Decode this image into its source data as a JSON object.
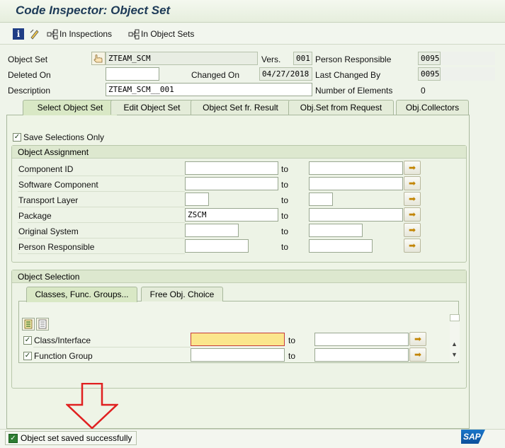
{
  "window": {
    "title": "Code Inspector: Object Set"
  },
  "toolbar": {
    "info_icon": "info-icon",
    "pencil_icon": "pencil-icon",
    "in_inspections_label": "In Inspections",
    "in_object_sets_label": "In Object Sets"
  },
  "header": {
    "object_set_label": "Object Set",
    "object_set_value": "ZTEAM_SCM",
    "vers_label": "Vers.",
    "vers_value": "001",
    "person_resp_label": "Person Responsible",
    "person_resp_value": "0095",
    "deleted_on_label": "Deleted On",
    "deleted_on_value": "",
    "changed_on_label": "Changed On",
    "changed_on_value": "04/27/2018",
    "last_changed_by_label": "Last Changed By",
    "last_changed_by_value": "0095",
    "description_label": "Description",
    "description_value": "ZTEAM_SCM__001",
    "num_elements_label": "Number of Elements",
    "num_elements_value": "0"
  },
  "tabs": [
    {
      "label": "Select Object Set",
      "active": true
    },
    {
      "label": "Edit Object Set",
      "active": false
    },
    {
      "label": "Object Set fr. Result",
      "active": false
    },
    {
      "label": "Obj.Set from Request",
      "active": false
    },
    {
      "label": "Obj.Collectors",
      "active": false
    }
  ],
  "save_selections_only": {
    "label": "Save Selections Only",
    "checked": true
  },
  "object_assignment": {
    "title": "Object Assignment",
    "to_label": "to",
    "rows": [
      {
        "label": "Component ID",
        "from": "",
        "to": ""
      },
      {
        "label": "Software Component",
        "from": "",
        "to": ""
      },
      {
        "label": "Transport Layer",
        "from": "",
        "to": ""
      },
      {
        "label": "Package",
        "from": "ZSCM",
        "to": ""
      },
      {
        "label": "Original System",
        "from": "",
        "to": ""
      },
      {
        "label": "Person Responsible",
        "from": "",
        "to": ""
      }
    ]
  },
  "object_selection": {
    "title": "Object Selection",
    "subtabs": [
      {
        "label": "Classes, Func. Groups...",
        "active": true
      },
      {
        "label": "Free Obj. Choice",
        "active": false
      }
    ],
    "to_label": "to",
    "rows": [
      {
        "label": "Class/Interface",
        "checked": true,
        "from": "",
        "to": ""
      },
      {
        "label": "Function Group",
        "checked": true,
        "from": "",
        "to": ""
      }
    ]
  },
  "status": {
    "message": "Object set saved successfully",
    "status_icon": "success-check-icon",
    "logo_text": "SAP"
  },
  "colors": {
    "title": "#1d3a57",
    "status_ok": "#2e7d32",
    "annotation_arrow": "#e02020",
    "sap_blue": "#0a4f9a"
  }
}
